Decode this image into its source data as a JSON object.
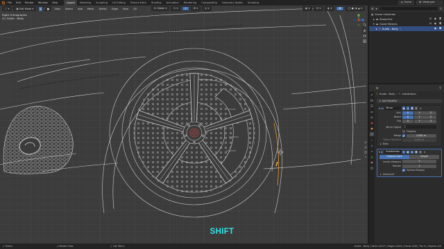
{
  "menu": {
    "items": [
      "File",
      "Edit",
      "Render",
      "Window",
      "Help"
    ]
  },
  "workspaces": {
    "items": [
      "Layout",
      "Modeling",
      "Sculpting",
      "UV Editing",
      "Texture Paint",
      "Shading",
      "Animation",
      "Rendering",
      "Compositing",
      "Geometry Nodes",
      "Scripting"
    ],
    "active": "Layout"
  },
  "topright": {
    "scene": "Scene",
    "view_layer": "ViewLayer"
  },
  "viewport": {
    "mode": "Edit Mode",
    "menus": [
      "View",
      "Select",
      "Add",
      "Mesh",
      "Vertex",
      "Edge",
      "Face",
      "UV"
    ],
    "transform_orientation": "Global",
    "info_line1": "Right Orthographic",
    "info_line2": "(1) Guide - Body",
    "overlay_text": "SHIFT"
  },
  "outliner": {
    "rows": [
      {
        "label": "Scene Collection",
        "selected": false
      },
      {
        "label": "Blueprints",
        "selected": false
      },
      {
        "label": "Guide Meshes",
        "selected": false
      },
      {
        "label": "Guide - Body",
        "selected": true
      }
    ]
  },
  "properties": {
    "object_name": "Guide - Body",
    "modifier_context": "Subdivision",
    "add_modifier": "Add Modifier",
    "mirror": {
      "name": "Mirror",
      "axis_label": "Axis",
      "bisect_label": "Bisect",
      "flip_label": "Flip",
      "x": "X",
      "y": "Y",
      "z": "Z",
      "mirror_object_label": "Mirror Object",
      "clipping_label": "Clipping",
      "merge_label": "Merge",
      "merge_value": "0.001 m",
      "bisect_distance_label": "Bisect Distance",
      "bisect_distance_value": "0.001 m",
      "data_label": "Data"
    },
    "subdivision": {
      "name": "Subdivision",
      "catmull": "Catmull-Clark",
      "simple": "Simple",
      "levels_viewport_label": "Levels Viewport",
      "levels_viewport_value": "2",
      "render_label": "Render",
      "render_value": "2",
      "optimal_display_label": "Optimal Display",
      "advanced_label": "Advanced"
    }
  },
  "status": {
    "select": "Select",
    "rotate": "Rotate View",
    "menu": "Call Menu",
    "stats": "Guide - Body | Verts 0/417 | Edges 0/454 | Faces 0/39 | Tris 0 | Objects 0/4"
  },
  "colors": {
    "accent": "#4772b3",
    "overlay_text": "#2fe3e8",
    "wire": "#cfcfcf",
    "vertex": "#111111"
  }
}
